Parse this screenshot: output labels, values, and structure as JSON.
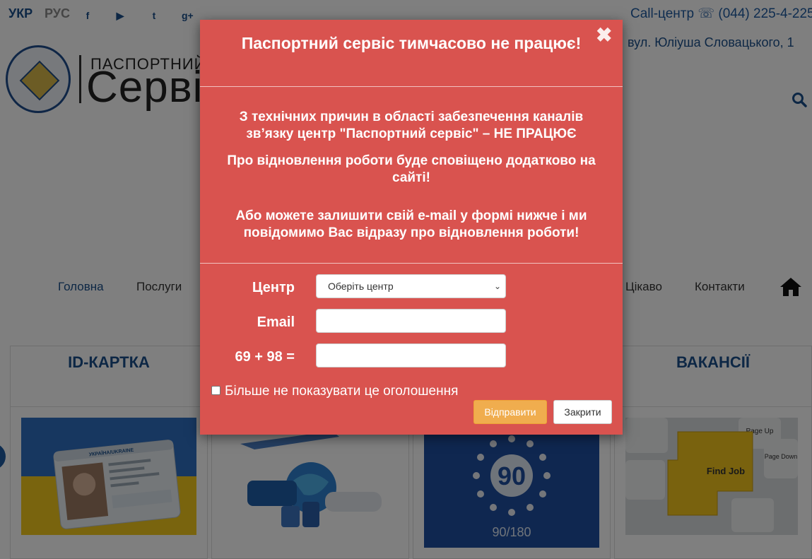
{
  "header": {
    "lang_ukr": "УКР",
    "lang_rus": "РУС",
    "social_icons": [
      "facebook-icon",
      "youtube-icon",
      "twitter-icon",
      "google-plus-icon"
    ],
    "social_glyphs": [
      "f",
      "▶",
      "t",
      "g+"
    ],
    "call_center": "Call-центр ☏ (044) 225-4-225",
    "address": "вул. Юліуша Словацького, 1",
    "logo_small": "ПАСПОРТНИЙ",
    "logo_big": "Сервіс"
  },
  "nav": {
    "items": [
      "Головна",
      "Послуги",
      "Цікаво",
      "Контакти"
    ]
  },
  "cards": [
    {
      "title": "ID-КАРТКА"
    },
    {
      "title": ""
    },
    {
      "title": ""
    },
    {
      "title": "ВАКАНСІЇ"
    }
  ],
  "thumbs": {
    "euro_number": "90",
    "euro_caption": "90/180",
    "key_label": "Find Job",
    "key_pgup": "Page Up",
    "key_pgdn": "Page Down",
    "id_card_header": "УКРАЇНА/UKRAINE"
  },
  "modal": {
    "title": "Паспортний сервіс тимчасово не працює!",
    "close_glyph": "✖",
    "message_1": "З технічних причин в області забезпечення каналів зв’язку центр \"Паспортний сервіс\" – НЕ ПРАЦЮЄ",
    "message_2": "Про відновлення роботи буде сповіщено додатково на сайті!",
    "message_3": "Або можете залишити свій e-mail у формі нижче і ми повідомимо Вас відразу про відновлення роботи!",
    "form": {
      "center_label": "Центр",
      "center_value": "Оберіть центр",
      "email_label": "Email",
      "email_value": "",
      "captcha_label": "69 + 98 =",
      "captcha_value": ""
    },
    "dont_show_label": "Більше не показувати це оголошення",
    "dont_show_checked": false,
    "send_label": "Відправити",
    "close_label": "Закрити"
  },
  "colors": {
    "modal_bg": "#d9534f",
    "brand_blue": "#1a4f8a",
    "send_button": "#f0ad4e"
  }
}
